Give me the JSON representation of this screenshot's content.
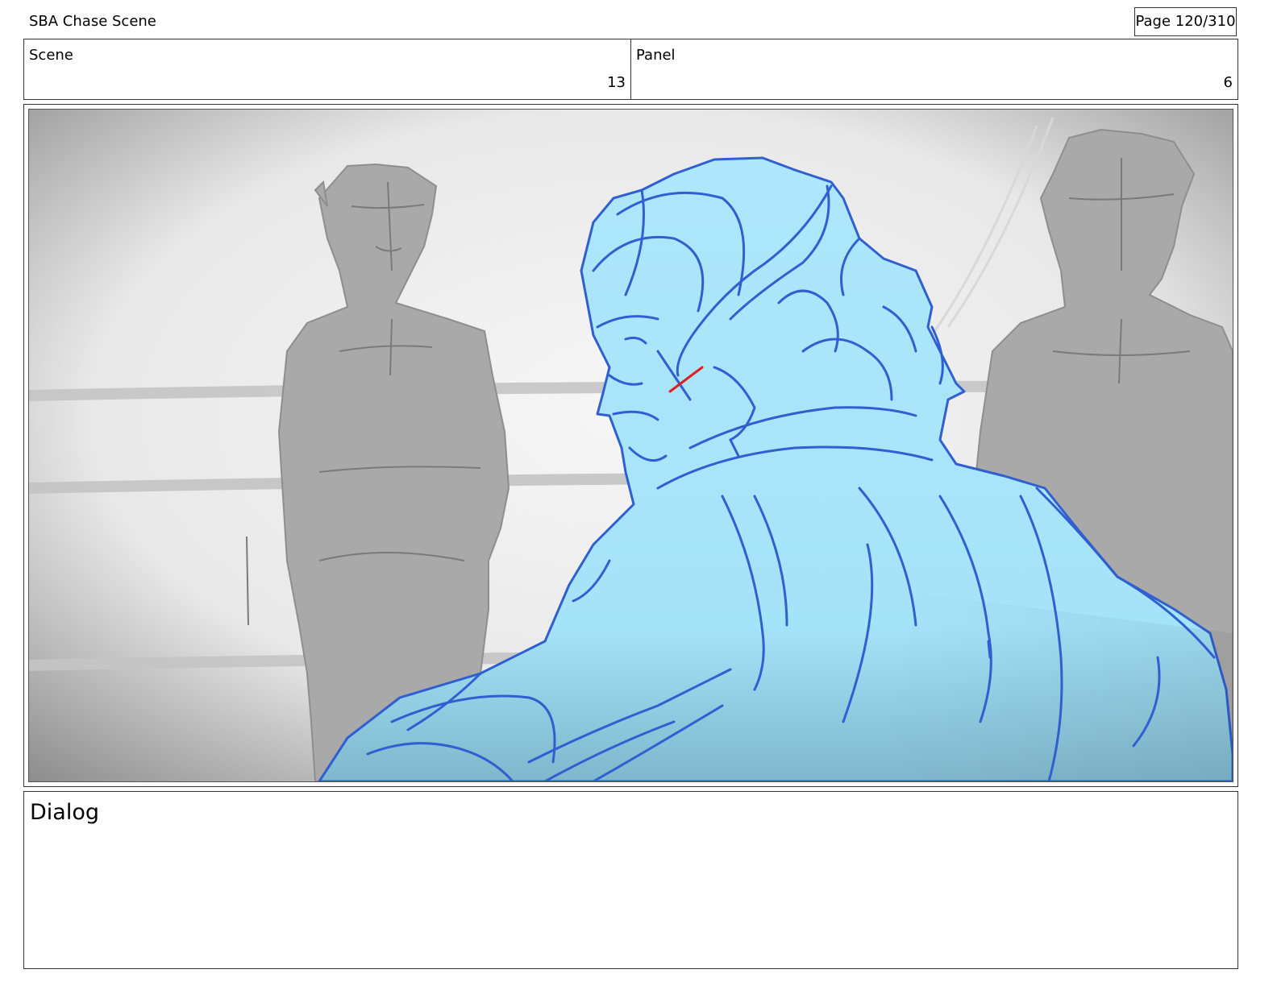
{
  "header": {
    "title": "SBA Chase Scene",
    "page": "Page 120/310"
  },
  "scene": {
    "label": "Scene",
    "value": "13"
  },
  "panel": {
    "label": "Panel",
    "value": "6"
  },
  "dialog": {
    "label": "Dialog"
  }
}
